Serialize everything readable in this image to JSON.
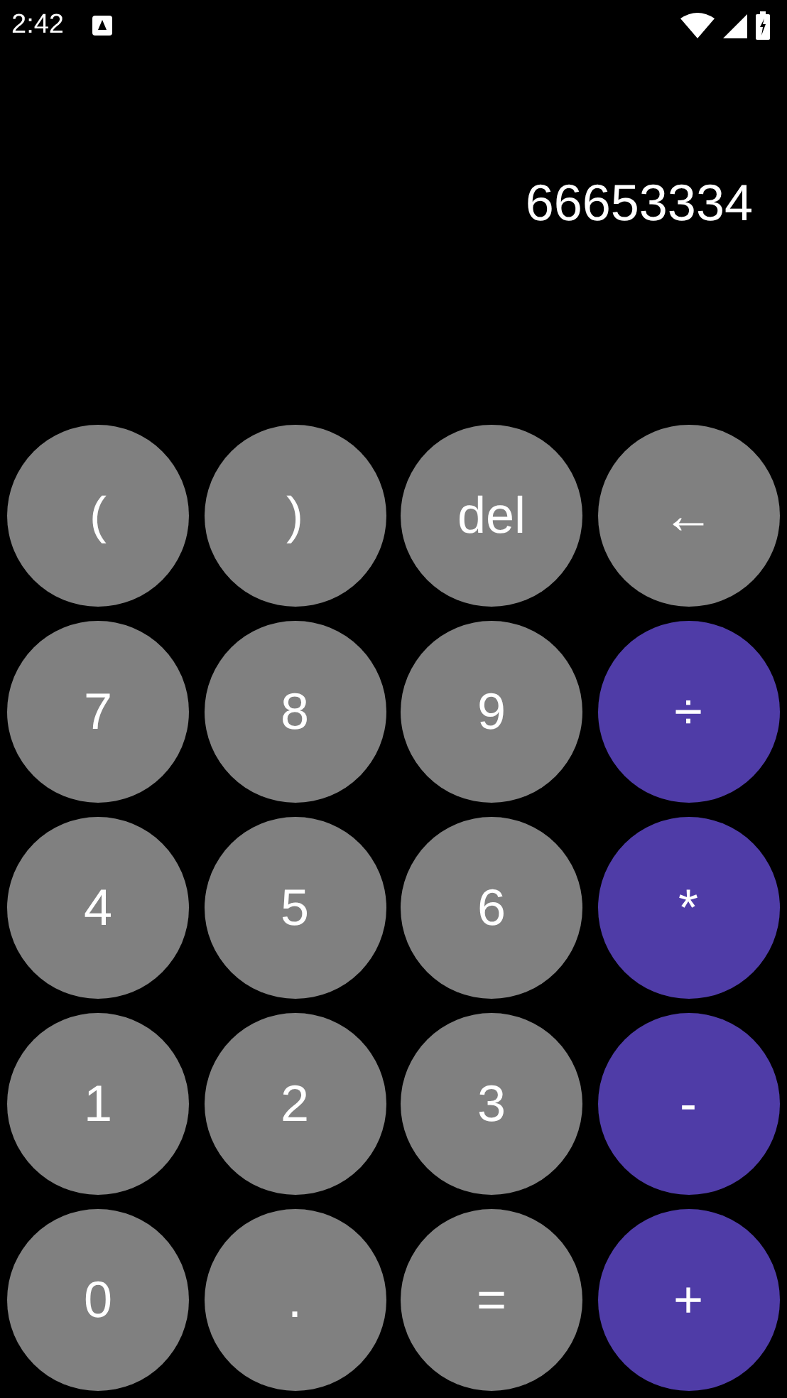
{
  "status_bar": {
    "time": "2:42"
  },
  "display": {
    "value": "66653334"
  },
  "keys": [
    {
      "label": "(",
      "kind": "plain"
    },
    {
      "label": ")",
      "kind": "plain"
    },
    {
      "label": "del",
      "kind": "plain"
    },
    {
      "label": "←",
      "kind": "plain"
    },
    {
      "label": "7",
      "kind": "plain"
    },
    {
      "label": "8",
      "kind": "plain"
    },
    {
      "label": "9",
      "kind": "plain"
    },
    {
      "label": "÷",
      "kind": "operator"
    },
    {
      "label": "4",
      "kind": "plain"
    },
    {
      "label": "5",
      "kind": "plain"
    },
    {
      "label": "6",
      "kind": "plain"
    },
    {
      "label": "*",
      "kind": "operator"
    },
    {
      "label": "1",
      "kind": "plain"
    },
    {
      "label": "2",
      "kind": "plain"
    },
    {
      "label": "3",
      "kind": "plain"
    },
    {
      "label": "-",
      "kind": "operator"
    },
    {
      "label": "0",
      "kind": "plain"
    },
    {
      "label": ".",
      "kind": "plain"
    },
    {
      "label": "=",
      "kind": "plain"
    },
    {
      "label": "+",
      "kind": "operator"
    }
  ]
}
